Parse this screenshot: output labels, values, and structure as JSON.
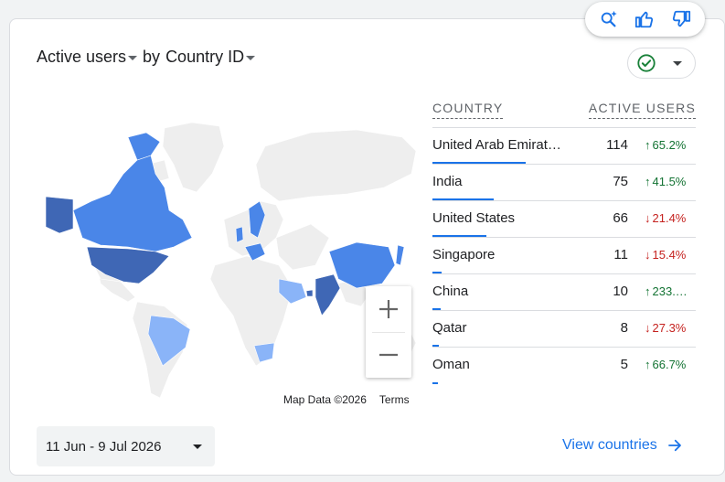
{
  "header": {
    "metric": "Active users",
    "connector": "by",
    "dimension": "Country ID"
  },
  "float_actions": [
    "insights-icon",
    "thumbs-up-icon",
    "thumbs-down-icon"
  ],
  "status": {
    "icon": "check-circle-icon",
    "color": "#188038"
  },
  "map": {
    "attribution": "Map Data ©2026",
    "terms": "Terms",
    "zoom_in": "+",
    "zoom_out": "−",
    "colors": {
      "high": "#3f67b5",
      "mid": "#4a86e8",
      "low": "#8ab4f8",
      "none": "#eeeeee"
    }
  },
  "table": {
    "headers": {
      "country": "COUNTRY",
      "active_users": "ACTIVE USERS"
    },
    "rows": [
      {
        "country": "United Arab Emirat…",
        "value": "114",
        "delta": "65.2%",
        "dir": "up",
        "share": 1.0
      },
      {
        "country": "India",
        "value": "75",
        "delta": "41.5%",
        "dir": "up",
        "share": 0.66
      },
      {
        "country": "United States",
        "value": "66",
        "delta": "21.4%",
        "dir": "down",
        "share": 0.58
      },
      {
        "country": "Singapore",
        "value": "11",
        "delta": "15.4%",
        "dir": "down",
        "share": 0.097
      },
      {
        "country": "China",
        "value": "10",
        "delta": "233.…",
        "dir": "up",
        "share": 0.088
      },
      {
        "country": "Qatar",
        "value": "8",
        "delta": "27.3%",
        "dir": "down",
        "share": 0.07
      },
      {
        "country": "Oman",
        "value": "5",
        "delta": "66.7%",
        "dir": "up",
        "share": 0.044
      }
    ]
  },
  "footer": {
    "date_range": "11 Jun - 9 Jul 2026",
    "view_link": "View countries"
  }
}
